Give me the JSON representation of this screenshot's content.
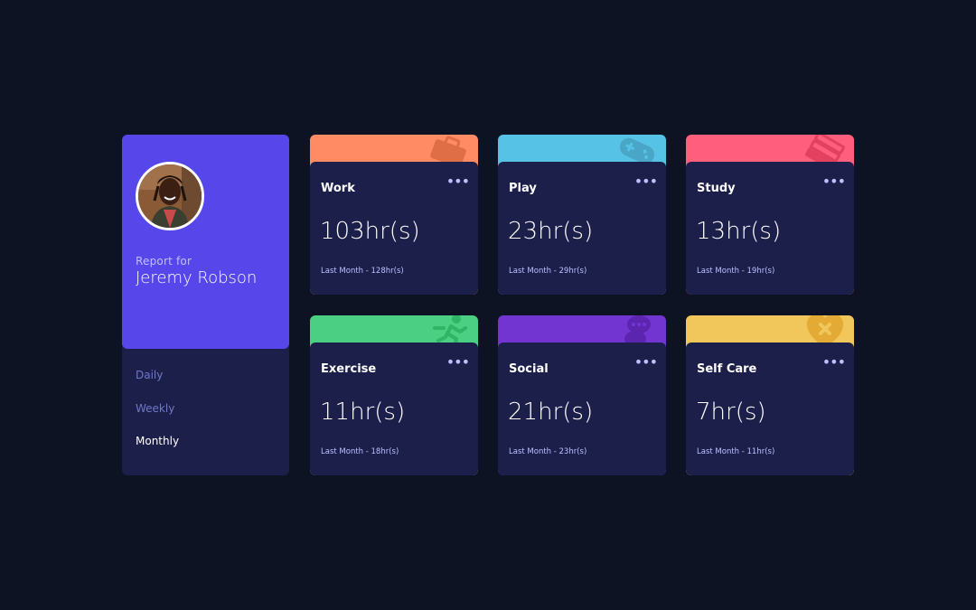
{
  "profile": {
    "report_label": "Report for",
    "name": "Jeremy Robson",
    "avatar_icon": "user-avatar"
  },
  "periods": [
    {
      "label": "Daily",
      "active": false
    },
    {
      "label": "Weekly",
      "active": false
    },
    {
      "label": "Monthly",
      "active": true
    }
  ],
  "activities": [
    {
      "title": "Work",
      "current": "103hr(s)",
      "previous": "Last Month - 128hr(s)",
      "color": "#ff8b64",
      "icon": "briefcase-icon"
    },
    {
      "title": "Play",
      "current": "23hr(s)",
      "previous": "Last Month - 29hr(s)",
      "color": "#55c2e6",
      "icon": "gamepad-icon"
    },
    {
      "title": "Study",
      "current": "13hr(s)",
      "previous": "Last Month - 19hr(s)",
      "color": "#ff5e7d",
      "icon": "books-icon"
    },
    {
      "title": "Exercise",
      "current": "11hr(s)",
      "previous": "Last Month - 18hr(s)",
      "color": "#4bcf82",
      "icon": "running-person-icon"
    },
    {
      "title": "Social",
      "current": "21hr(s)",
      "previous": "Last Month - 23hr(s)",
      "color": "#7335d2",
      "icon": "chat-bubbles-icon"
    },
    {
      "title": "Self Care",
      "current": "7hr(s)",
      "previous": "Last Month - 11hr(s)",
      "color": "#f1c75b",
      "icon": "heart-plus-icon"
    }
  ],
  "ellipsis_label": "•••"
}
